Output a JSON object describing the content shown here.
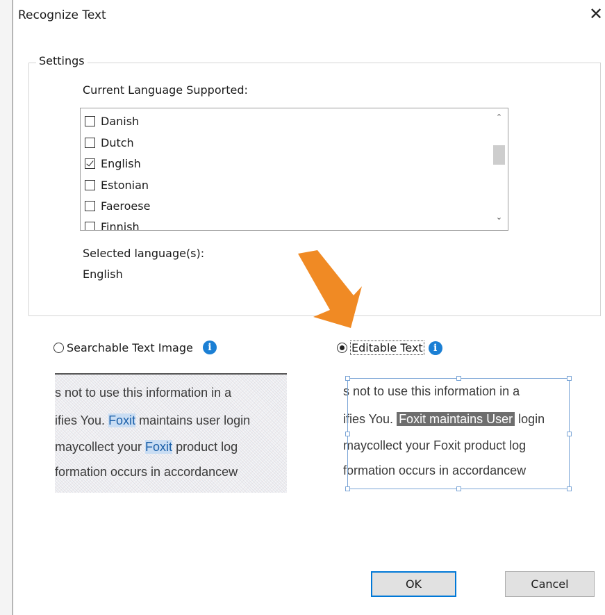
{
  "dialog": {
    "title": "Recognize Text",
    "close_glyph": "✕"
  },
  "settings": {
    "legend": "Settings",
    "current_language_label": "Current Language Supported:",
    "languages": [
      {
        "label": "Danish",
        "checked": false
      },
      {
        "label": "Dutch",
        "checked": false
      },
      {
        "label": "English",
        "checked": true
      },
      {
        "label": "Estonian",
        "checked": false
      },
      {
        "label": "Faeroese",
        "checked": false
      },
      {
        "label": "Finnish",
        "checked": false
      }
    ],
    "selected_label": "Selected language(s):",
    "selected_value": "English"
  },
  "options": {
    "searchable": {
      "label": "Searchable Text Image",
      "selected": false
    },
    "editable": {
      "label": "Editable Text",
      "selected": true
    }
  },
  "preview": {
    "lines": [
      "s not to use this information in a",
      "ifies You. Foxit maintains user login",
      "maycollect your Foxit product log",
      "formation occurs in accordancew"
    ],
    "searchable_parts": {
      "l2a": "ifies You. ",
      "l2b": "Foxit",
      "l2c": " maintains user login",
      "l3a": "maycollect your ",
      "l3b": "Foxit",
      "l3c": " product log"
    },
    "editable_parts": {
      "l2a": "ifies You. ",
      "l2b": "Foxit maintains User",
      "l2c": " login",
      "l3": "maycollect your  Foxit product log"
    }
  },
  "buttons": {
    "ok": "OK",
    "cancel": "Cancel"
  },
  "colors": {
    "accent_arrow": "#f08a24",
    "info_icon": "#1b7fd4",
    "ok_border": "#0078d7"
  },
  "icons": [
    "close-icon",
    "checkbox",
    "scroll-up-icon",
    "scroll-down-icon",
    "info-icon",
    "arrow-pointer"
  ]
}
